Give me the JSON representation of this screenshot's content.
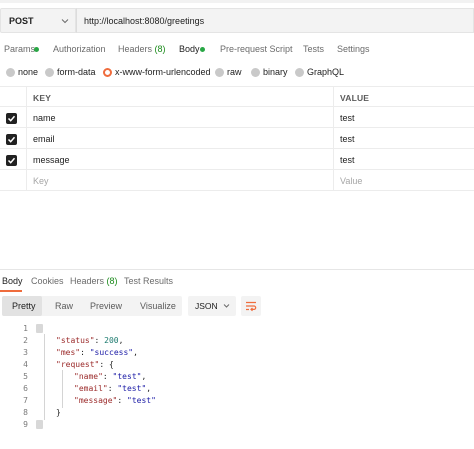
{
  "request": {
    "method": "POST",
    "url": "http://localhost:8080/greetings"
  },
  "request_tabs": {
    "params": "Params",
    "authorization": "Authorization",
    "headers": "Headers",
    "headers_count": "(8)",
    "body": "Body",
    "prerequest": "Pre-request Script",
    "tests": "Tests",
    "settings": "Settings"
  },
  "body_types": {
    "none": "none",
    "form_data": "form-data",
    "urlencoded": "x-www-form-urlencoded",
    "raw": "raw",
    "binary": "binary",
    "graphql": "GraphQL",
    "selected": "x-www-form-urlencoded"
  },
  "params_table": {
    "key_header": "KEY",
    "value_header": "VALUE",
    "rows": [
      {
        "key": "name",
        "value": "test",
        "checked": true
      },
      {
        "key": "email",
        "value": "test",
        "checked": true
      },
      {
        "key": "message",
        "value": "test",
        "checked": true
      }
    ],
    "key_placeholder": "Key",
    "value_placeholder": "Value"
  },
  "response_tabs": {
    "body": "Body",
    "cookies": "Cookies",
    "headers": "Headers",
    "headers_count": "(8)",
    "test_results": "Test Results"
  },
  "response_view": {
    "pretty": "Pretty",
    "raw": "Raw",
    "preview": "Preview",
    "visualize": "Visualize",
    "format": "JSON"
  },
  "response_body": {
    "line_numbers": [
      "1",
      "2",
      "3",
      "4",
      "5",
      "6",
      "7",
      "8",
      "9"
    ],
    "status_key": "\"status\"",
    "status_value": "200",
    "mes_key": "\"mes\"",
    "mes_value": "\"success\"",
    "request_key": "\"request\"",
    "name_key": "\"name\"",
    "name_value": "\"test\"",
    "email_key": "\"email\"",
    "email_value": "\"test\"",
    "message_key": "\"message\"",
    "message_value": "\"test\""
  },
  "colors": {
    "accent": "#ef6c3d",
    "status_dot": "#28a745",
    "json_key": "#9b2a2a",
    "json_string": "#1a1aa6",
    "json_number": "#1b7a6e"
  }
}
